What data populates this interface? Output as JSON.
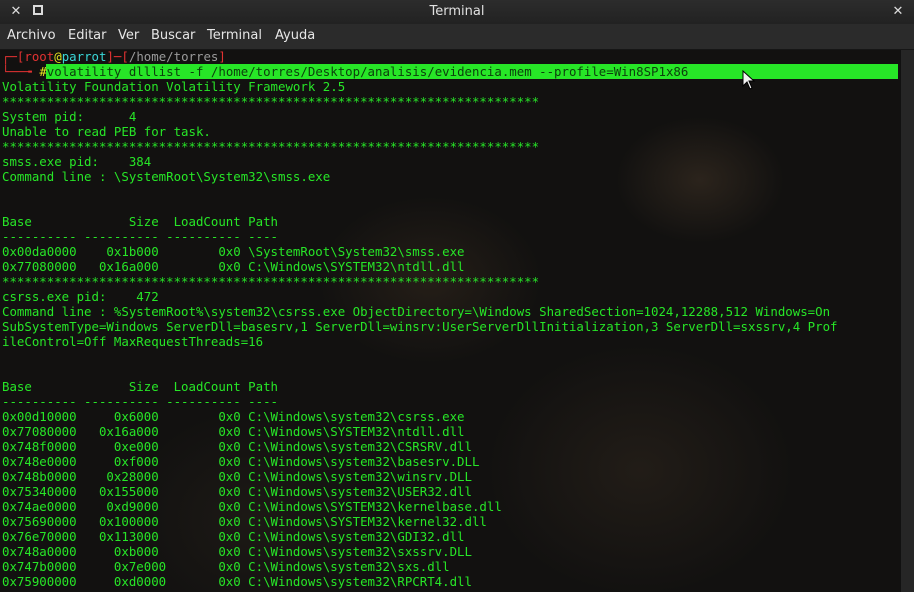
{
  "window": {
    "title": "Terminal",
    "close_glyph": "✕",
    "maximize_glyph": "",
    "close_right_glyph": "✕"
  },
  "menu": [
    "Archivo",
    "Editar",
    "Ver",
    "Buscar",
    "Terminal",
    "Ayuda"
  ],
  "prompt": {
    "open": "┌─[",
    "user": "root",
    "at": "@",
    "host": "parrot",
    "mid": "]─[",
    "path": "/home/torres",
    "close": "]",
    "line2": "└──╼ ",
    "hash": "#",
    "command": "volatility dlllist -f /home/torres/Desktop/analisis/evidencia.mem --profile=Win8SP1x86"
  },
  "output": [
    "Volatility Foundation Volatility Framework 2.5",
    "************************************************************************",
    "System pid:      4",
    "Unable to read PEB for task.",
    "************************************************************************",
    "smss.exe pid:    384",
    "Command line : \\SystemRoot\\System32\\smss.exe",
    "",
    "",
    "Base             Size  LoadCount Path",
    "---------- ---------- ---------- ----",
    "0x00da0000    0x1b000        0x0 \\SystemRoot\\System32\\smss.exe",
    "0x77080000   0x16a000        0x0 C:\\Windows\\SYSTEM32\\ntdll.dll",
    "************************************************************************",
    "csrss.exe pid:    472",
    "Command line : %SystemRoot%\\system32\\csrss.exe ObjectDirectory=\\Windows SharedSection=1024,12288,512 Windows=On",
    "SubSystemType=Windows ServerDll=basesrv,1 ServerDll=winsrv:UserServerDllInitialization,3 ServerDll=sxssrv,4 Prof",
    "ileControl=Off MaxRequestThreads=16",
    "",
    "",
    "Base             Size  LoadCount Path",
    "---------- ---------- ---------- ----",
    "0x00d10000     0x6000        0x0 C:\\Windows\\system32\\csrss.exe",
    "0x77080000   0x16a000        0x0 C:\\Windows\\SYSTEM32\\ntdll.dll",
    "0x748f0000     0xe000        0x0 C:\\Windows\\system32\\CSRSRV.dll",
    "0x748e0000     0xf000        0x0 C:\\Windows\\system32\\basesrv.DLL",
    "0x748b0000    0x28000        0x0 C:\\Windows\\system32\\winsrv.DLL",
    "0x75340000   0x155000        0x0 C:\\Windows\\system32\\USER32.dll",
    "0x74ae0000    0xd9000        0x0 C:\\Windows\\SYSTEM32\\kernelbase.dll",
    "0x75690000   0x100000        0x0 C:\\Windows\\SYSTEM32\\kernel32.dll",
    "0x76e70000   0x113000        0x0 C:\\Windows\\system32\\GDI32.dll",
    "0x748a0000     0xb000        0x0 C:\\Windows\\system32\\sxssrv.DLL",
    "0x747b0000     0x7e000       0x0 C:\\Windows\\system32\\sxs.dll",
    "0x75900000     0xd0000       0x0 C:\\Windows\\system32\\RPCRT4.dll"
  ]
}
